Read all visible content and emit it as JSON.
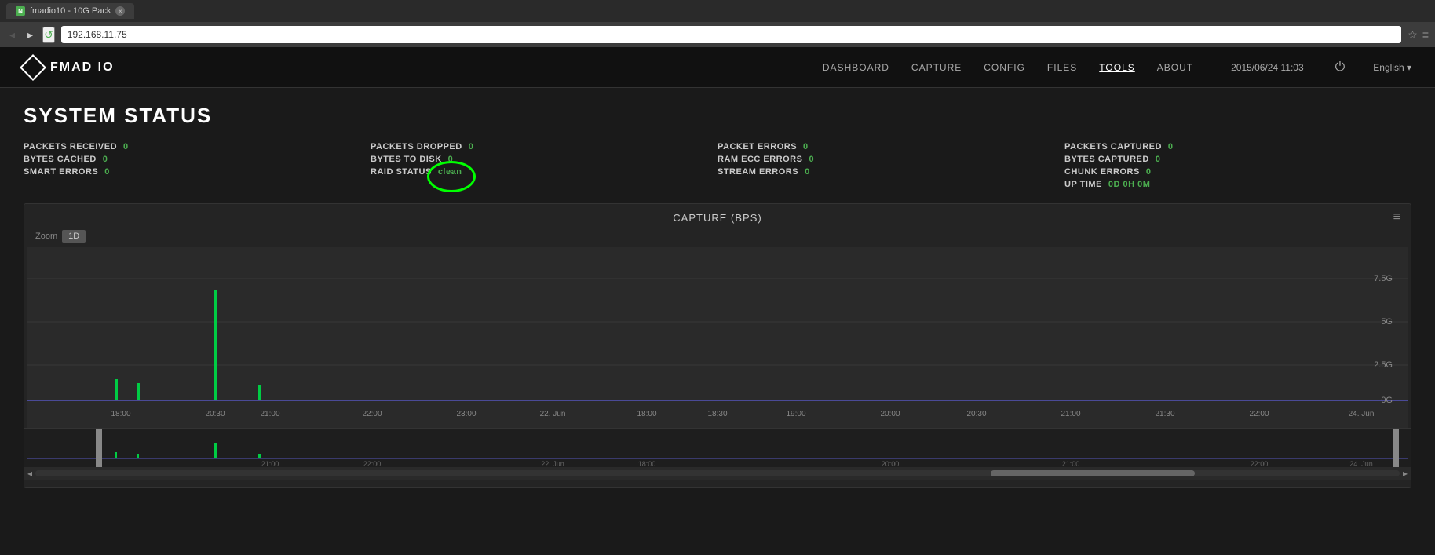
{
  "browser": {
    "tab_label": "fmadio10 - 10G Pack",
    "favicon_text": "N",
    "address": "192.168.11.75",
    "close_icon": "×"
  },
  "nav": {
    "back_icon": "◂",
    "forward_icon": "▸",
    "refresh_icon": "↺",
    "bookmark_icon": "☆",
    "menu_icon": "≡"
  },
  "header": {
    "logo_text": "FMAD IO",
    "links": [
      {
        "label": "DASHBOARD",
        "active": false
      },
      {
        "label": "CAPTURE",
        "active": false
      },
      {
        "label": "CONFIG",
        "active": false
      },
      {
        "label": "FILES",
        "active": false
      },
      {
        "label": "TOOLS",
        "active": true
      },
      {
        "label": "ABOUT",
        "active": false
      }
    ],
    "timestamp": "2015/06/24 11:03",
    "power_icon": "⏻",
    "language": "English ▾",
    "cursor_icon": "↖"
  },
  "system_status": {
    "title": "SYSTEM STATUS",
    "stats": [
      {
        "label": "PACKETS RECEIVED",
        "value": "0"
      },
      {
        "label": "PACKETS DROPPED",
        "value": "0"
      },
      {
        "label": "PACKET ERRORS",
        "value": "0"
      },
      {
        "label": "PACKETS CAPTURED",
        "value": "0"
      },
      {
        "label": "BYTES CACHED",
        "value": "0"
      },
      {
        "label": "BYTES TO DISK",
        "value": "0"
      },
      {
        "label": "RAM ECC ERRORS",
        "value": "0"
      },
      {
        "label": "BYTES CAPTURED",
        "value": "0"
      },
      {
        "label": "SMART ERRORS",
        "value": "0"
      },
      {
        "label": "RAID STATUS",
        "value": "clean",
        "is_clean": true
      },
      {
        "label": "STREAM ERRORS",
        "value": "0"
      },
      {
        "label": "CHUNK ERRORS",
        "value": "0"
      },
      {
        "label": "UP TIME",
        "value": "0D 0H 0M"
      }
    ]
  },
  "chart": {
    "title": "CAPTURE (BPS)",
    "menu_icon": "≡",
    "zoom_label": "Zoom",
    "zoom_btn_label": "1D",
    "y_labels": [
      "7.5G",
      "5G",
      "2.5G",
      "0G"
    ],
    "x_labels": [
      "18:00",
      "20:30",
      "21:00",
      "22:00",
      "23:00",
      "22. Jun",
      "18:00",
      "18:30",
      "19:00",
      "20:00",
      "20:30",
      "21:00",
      "21:30",
      "22:00",
      "24. Jun"
    ],
    "mini_x_labels": [
      "21:00",
      "22:00",
      "22. Jun",
      "18:00",
      "20:00",
      "21:00",
      "22:00",
      "24. Jun"
    ],
    "scrollbar_left_icon": "◂",
    "scrollbar_right_icon": "▸",
    "scrollbar_center_icon": "▐▌"
  }
}
